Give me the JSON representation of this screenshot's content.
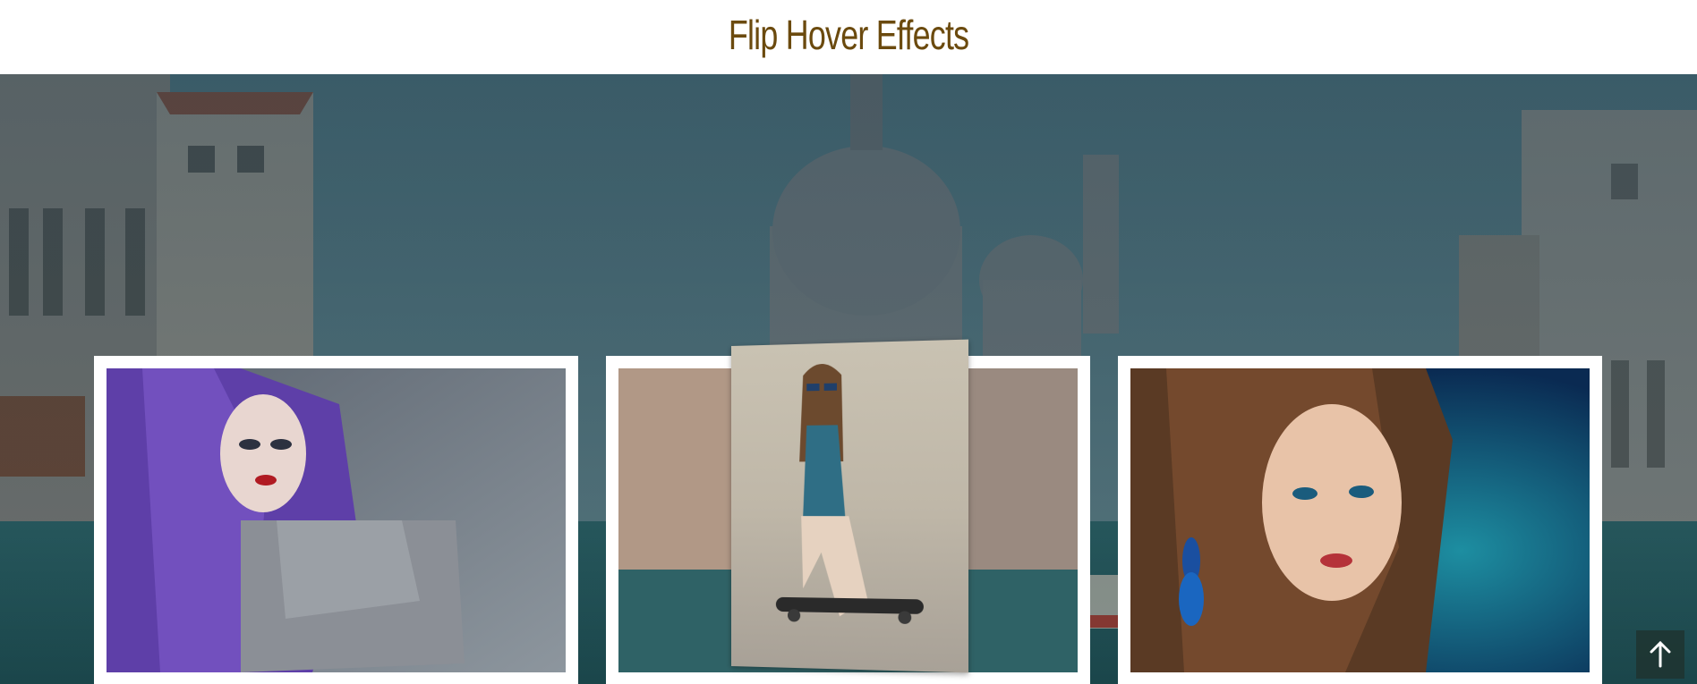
{
  "header": {
    "title": "Flip Hover Effects"
  },
  "gallery": {
    "cards": [
      {
        "name": "purple-hair-portrait"
      },
      {
        "name": "skateboard-girl"
      },
      {
        "name": "blue-earrings-portrait"
      }
    ]
  },
  "scroll_top": {
    "icon": "arrow-up-icon"
  },
  "colors": {
    "title": "#6b4a0e",
    "overlay": "#203e4a",
    "card_border": "#ffffff"
  }
}
